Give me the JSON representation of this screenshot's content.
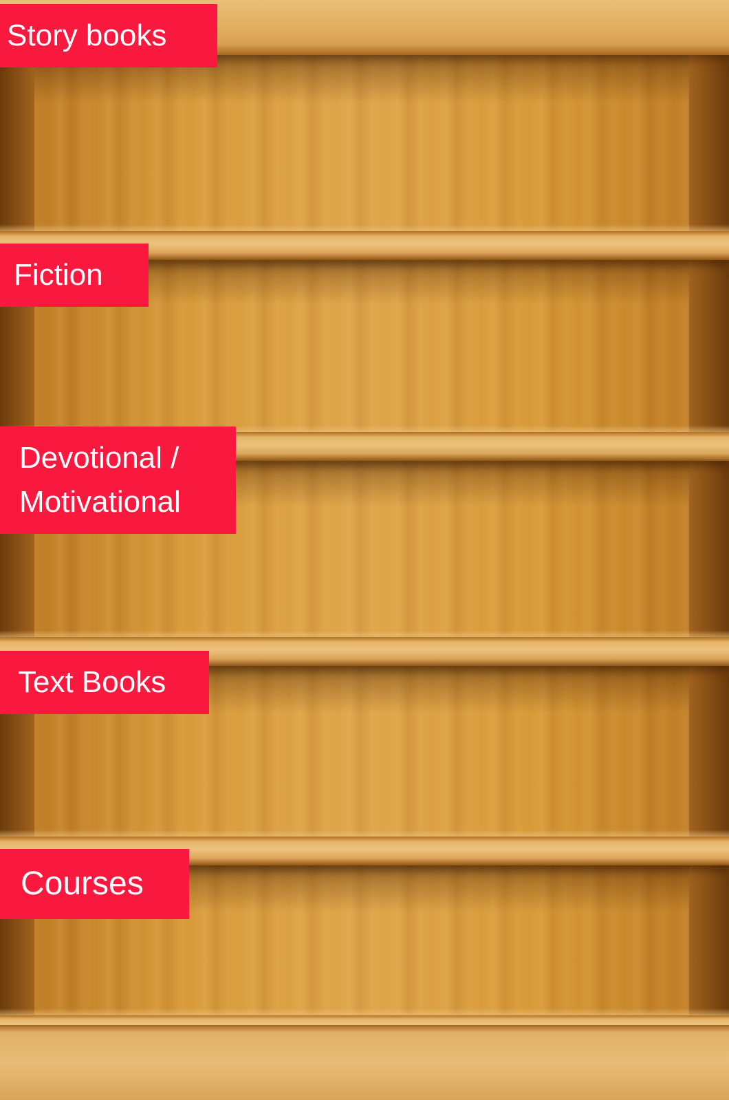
{
  "categories": [
    {
      "label": "Story books"
    },
    {
      "label": "Fiction"
    },
    {
      "label": "Devotional /\nMotivational"
    },
    {
      "label": "Text Books"
    },
    {
      "label": "Courses"
    }
  ],
  "colors": {
    "label_background": "#fa193e",
    "label_text": "#ffffff",
    "wood_light": "#dfa54a",
    "wood_dark": "#6b3b0b"
  }
}
